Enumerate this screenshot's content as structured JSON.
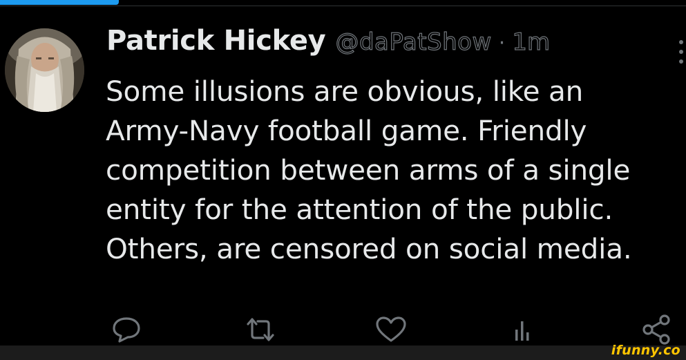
{
  "tweet": {
    "display_name": "Patrick Hickey",
    "handle": "@daPatShow",
    "separator": "·",
    "time": "1m",
    "text_lines": [
      "Some illusions are obvious, like an",
      "Army-Navy football game. Friendly",
      "competition between arms of a single",
      "entity for the attention of the public.",
      "Others, are censored on social media."
    ]
  },
  "actions": {
    "reply_icon": "reply-icon",
    "retweet_icon": "retweet-icon",
    "like_icon": "heart-icon",
    "views_icon": "analytics-icon",
    "share_icon": "share-icon"
  },
  "watermark": "ifunny.co",
  "colors": {
    "background": "#000000",
    "text": "#e7e9ea",
    "muted": "#71767b",
    "accent": "#1d9bf0",
    "watermark": "#ffc500"
  }
}
